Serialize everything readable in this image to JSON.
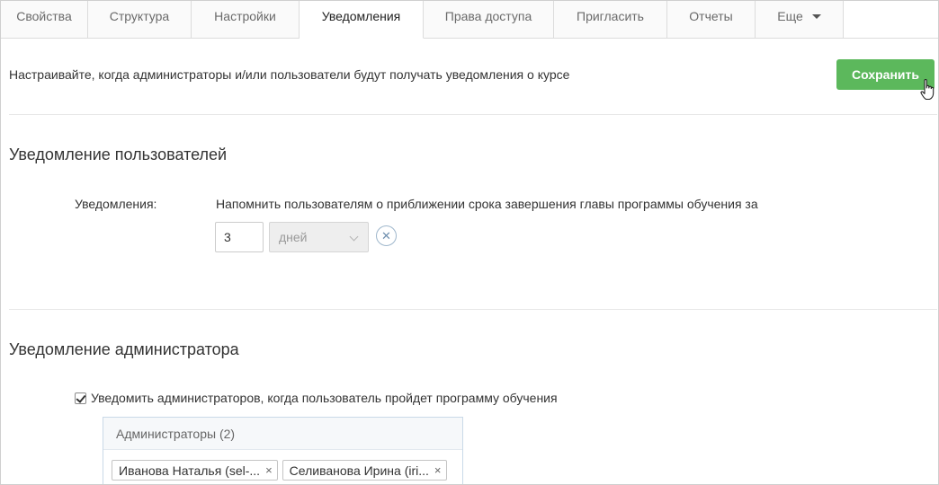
{
  "tabs": [
    {
      "label": "Свойства"
    },
    {
      "label": "Структура"
    },
    {
      "label": "Настройки"
    },
    {
      "label": "Уведомления"
    },
    {
      "label": "Права доступа"
    },
    {
      "label": "Пригласить"
    },
    {
      "label": "Отчеты"
    },
    {
      "label": "Еще"
    }
  ],
  "active_tab": "Уведомления",
  "description": "Настраивайте, когда администраторы и/или пользователи будут получать уведомления о курсе",
  "save_label": "Сохранить",
  "user_section": {
    "title": "Уведомление пользователей",
    "field_label": "Уведомления:",
    "reminder_text": "Напомнить пользователям о приближении срока завершения главы программы обучения за",
    "days_value": "3",
    "unit_value": "дней",
    "remove_symbol": "✕"
  },
  "admin_section": {
    "title": "Уведомление администратора",
    "checkbox_label": "Уведомить администраторов, когда пользователь пройдет программу обучения",
    "checked": true,
    "admins_header": "Администраторы (2)",
    "admins": [
      {
        "name": "Иванова Наталья (sel-..."
      },
      {
        "name": "Селиванова Ирина (iri..."
      }
    ],
    "chip_remove_symbol": "×"
  },
  "colors": {
    "primary_button": "#5cb85c",
    "tab_border": "#dcdcdc",
    "admin_box_border": "#c9d9e8"
  }
}
